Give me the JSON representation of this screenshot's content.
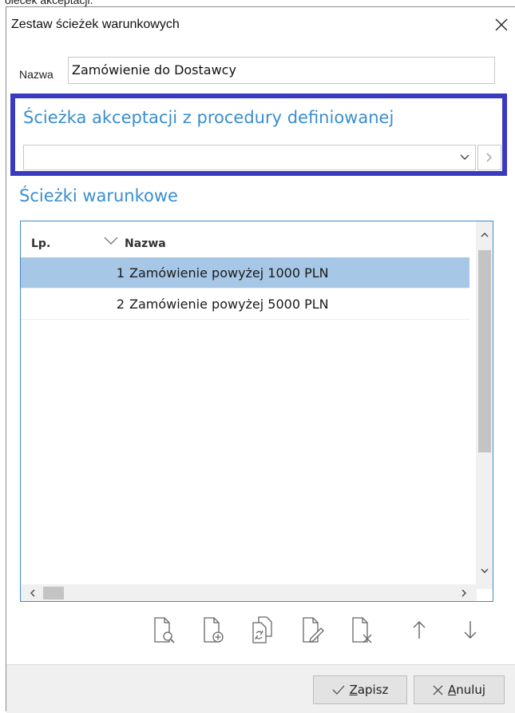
{
  "clipped_text": "oiecek akceptacji.",
  "window": {
    "title": "Zestaw ścieżek warunkowych"
  },
  "form": {
    "name_label": "Nazwa",
    "name_value": "Zamówienie do Dostawcy"
  },
  "acceptance_path": {
    "title": "Ścieżka akceptacji z procedury definiowanej",
    "value": ""
  },
  "conditional_paths": {
    "title": "Ścieżki warunkowe",
    "columns": {
      "lp": "Lp.",
      "nazwa": "Nazwa"
    },
    "rows": [
      {
        "lp": "1",
        "name": "Zamówienie powyżej 1000 PLN",
        "selected": true
      },
      {
        "lp": "2",
        "name": "Zamówienie powyżej 5000 PLN",
        "selected": false
      }
    ]
  },
  "toolbar": {
    "icons": [
      "preview-document-icon",
      "add-document-icon",
      "copy-document-icon",
      "edit-document-icon",
      "delete-document-icon",
      "move-up-icon",
      "move-down-icon"
    ]
  },
  "footer": {
    "save_first": "Z",
    "save_rest": "apisz",
    "cancel_first": "A",
    "cancel_rest": "nuluj"
  },
  "colors": {
    "accent": "#3a8ecf",
    "highlight_border": "#3a3ac0",
    "selected_row": "#a7c7e6"
  }
}
